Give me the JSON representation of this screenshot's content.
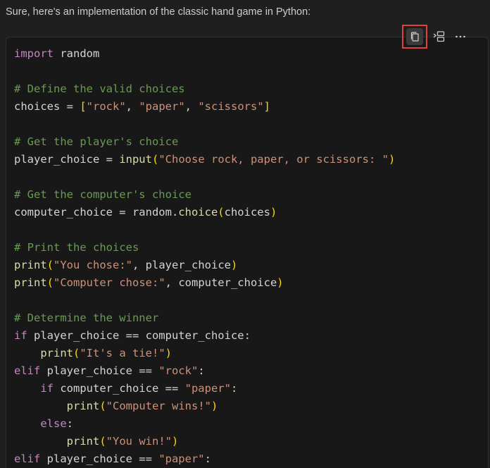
{
  "intro_text": "Sure, here's an implementation of the classic hand game in Python:",
  "toolbar": {
    "copy_icon": "copy-icon",
    "insert_icon": "insert-into-editor-icon",
    "more_icon": "more-icon"
  },
  "colors": {
    "background": "#1f1f1f",
    "code_background": "#181818",
    "keyword": "#c586c0",
    "comment": "#6a9955",
    "string": "#ce9178",
    "function": "#dcdcaa",
    "default": "#d4d4d4",
    "bracket": "#ffd700",
    "highlight_border": "#e0423f"
  },
  "code_lines": [
    [
      [
        "kw",
        "import"
      ],
      [
        "df",
        " random"
      ]
    ],
    [],
    [
      [
        "cm",
        "# Define the valid choices"
      ]
    ],
    [
      [
        "df",
        "choices = "
      ],
      [
        "br",
        "["
      ],
      [
        "st",
        "\"rock\""
      ],
      [
        "df",
        ", "
      ],
      [
        "st",
        "\"paper\""
      ],
      [
        "df",
        ", "
      ],
      [
        "st",
        "\"scissors\""
      ],
      [
        "br",
        "]"
      ]
    ],
    [],
    [
      [
        "cm",
        "# Get the player's choice"
      ]
    ],
    [
      [
        "df",
        "player_choice = "
      ],
      [
        "fn",
        "input"
      ],
      [
        "br",
        "("
      ],
      [
        "st",
        "\"Choose rock, paper, or scissors: \""
      ],
      [
        "br",
        ")"
      ]
    ],
    [],
    [
      [
        "cm",
        "# Get the computer's choice"
      ]
    ],
    [
      [
        "df",
        "computer_choice = random."
      ],
      [
        "fn",
        "choice"
      ],
      [
        "br",
        "("
      ],
      [
        "df",
        "choices"
      ],
      [
        "br",
        ")"
      ]
    ],
    [],
    [
      [
        "cm",
        "# Print the choices"
      ]
    ],
    [
      [
        "fn",
        "print"
      ],
      [
        "br",
        "("
      ],
      [
        "st",
        "\"You chose:\""
      ],
      [
        "df",
        ", player_choice"
      ],
      [
        "br",
        ")"
      ]
    ],
    [
      [
        "fn",
        "print"
      ],
      [
        "br",
        "("
      ],
      [
        "st",
        "\"Computer chose:\""
      ],
      [
        "df",
        ", computer_choice"
      ],
      [
        "br",
        ")"
      ]
    ],
    [],
    [
      [
        "cm",
        "# Determine the winner"
      ]
    ],
    [
      [
        "kw",
        "if"
      ],
      [
        "df",
        " player_choice == computer_choice:"
      ]
    ],
    [
      [
        "df",
        "    "
      ],
      [
        "fn",
        "print"
      ],
      [
        "br",
        "("
      ],
      [
        "st",
        "\"It's a tie!\""
      ],
      [
        "br",
        ")"
      ]
    ],
    [
      [
        "kw",
        "elif"
      ],
      [
        "df",
        " player_choice == "
      ],
      [
        "st",
        "\"rock\""
      ],
      [
        "df",
        ":"
      ]
    ],
    [
      [
        "df",
        "    "
      ],
      [
        "kw",
        "if"
      ],
      [
        "df",
        " computer_choice == "
      ],
      [
        "st",
        "\"paper\""
      ],
      [
        "df",
        ":"
      ]
    ],
    [
      [
        "df",
        "        "
      ],
      [
        "fn",
        "print"
      ],
      [
        "br",
        "("
      ],
      [
        "st",
        "\"Computer wins!\""
      ],
      [
        "br",
        ")"
      ]
    ],
    [
      [
        "df",
        "    "
      ],
      [
        "kw",
        "else"
      ],
      [
        "df",
        ":"
      ]
    ],
    [
      [
        "df",
        "        "
      ],
      [
        "fn",
        "print"
      ],
      [
        "br",
        "("
      ],
      [
        "st",
        "\"You win!\""
      ],
      [
        "br",
        ")"
      ]
    ],
    [
      [
        "kw",
        "elif"
      ],
      [
        "df",
        " player_choice == "
      ],
      [
        "st",
        "\"paper\""
      ],
      [
        "df",
        ":"
      ]
    ]
  ]
}
